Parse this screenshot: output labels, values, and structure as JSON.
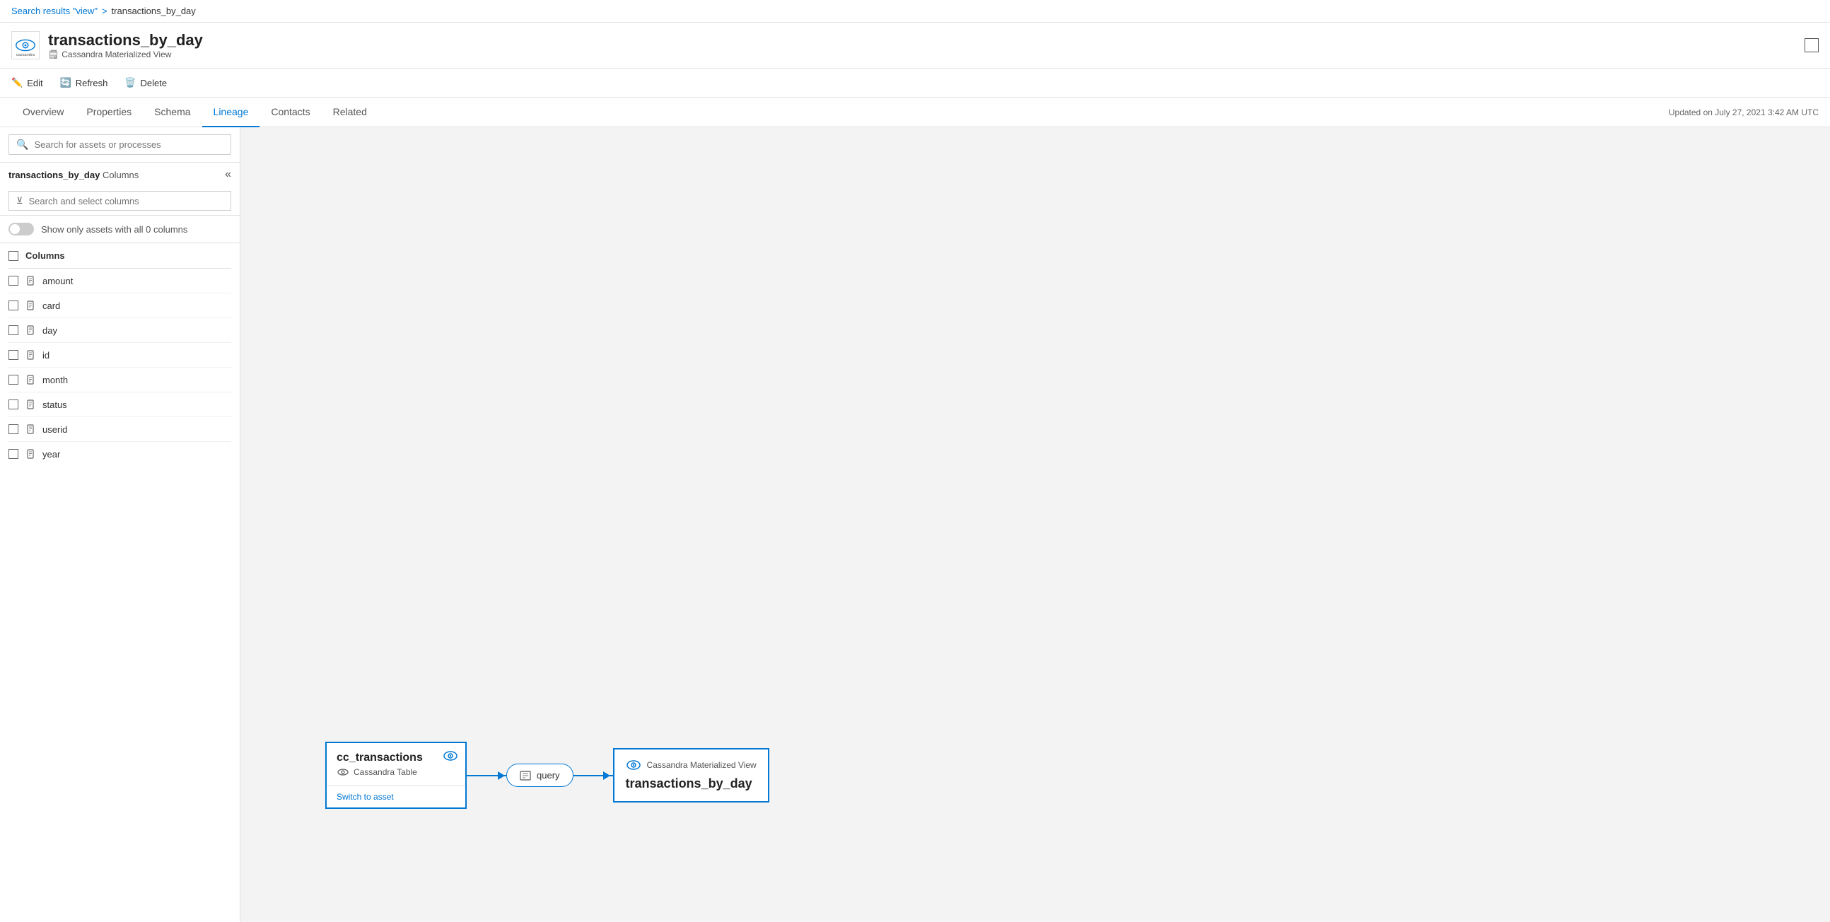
{
  "breadcrumb": {
    "link_text": "Search results \"view\"",
    "separator": ">",
    "current": "transactions_by_day"
  },
  "header": {
    "title": "transactions_by_day",
    "subtitle": "Cassandra Materialized View",
    "logo_alt": "cassandra-logo"
  },
  "toolbar": {
    "edit_label": "Edit",
    "refresh_label": "Refresh",
    "delete_label": "Delete"
  },
  "tabs": {
    "items": [
      "Overview",
      "Properties",
      "Schema",
      "Lineage",
      "Contacts",
      "Related"
    ],
    "active": "Lineage",
    "updated_text": "Updated on July 27, 2021 3:42 AM UTC"
  },
  "search_bar": {
    "placeholder": "Search for assets or processes"
  },
  "column_panel": {
    "asset_name": "transactions_by_day",
    "columns_label": "Columns",
    "search_placeholder": "Search and select columns",
    "toggle_label": "Show only assets with all 0 columns",
    "columns_header": "Columns",
    "columns": [
      {
        "name": "amount"
      },
      {
        "name": "card"
      },
      {
        "name": "day"
      },
      {
        "name": "id"
      },
      {
        "name": "month"
      },
      {
        "name": "status"
      },
      {
        "name": "userid"
      },
      {
        "name": "year"
      }
    ]
  },
  "lineage": {
    "source_node": {
      "title": "cc_transactions",
      "subtitle": "Cassandra Table",
      "link": "Switch to asset"
    },
    "process_node": {
      "label": "query"
    },
    "target_node": {
      "subtitle": "Cassandra Materialized View",
      "title": "transactions_by_day"
    }
  }
}
